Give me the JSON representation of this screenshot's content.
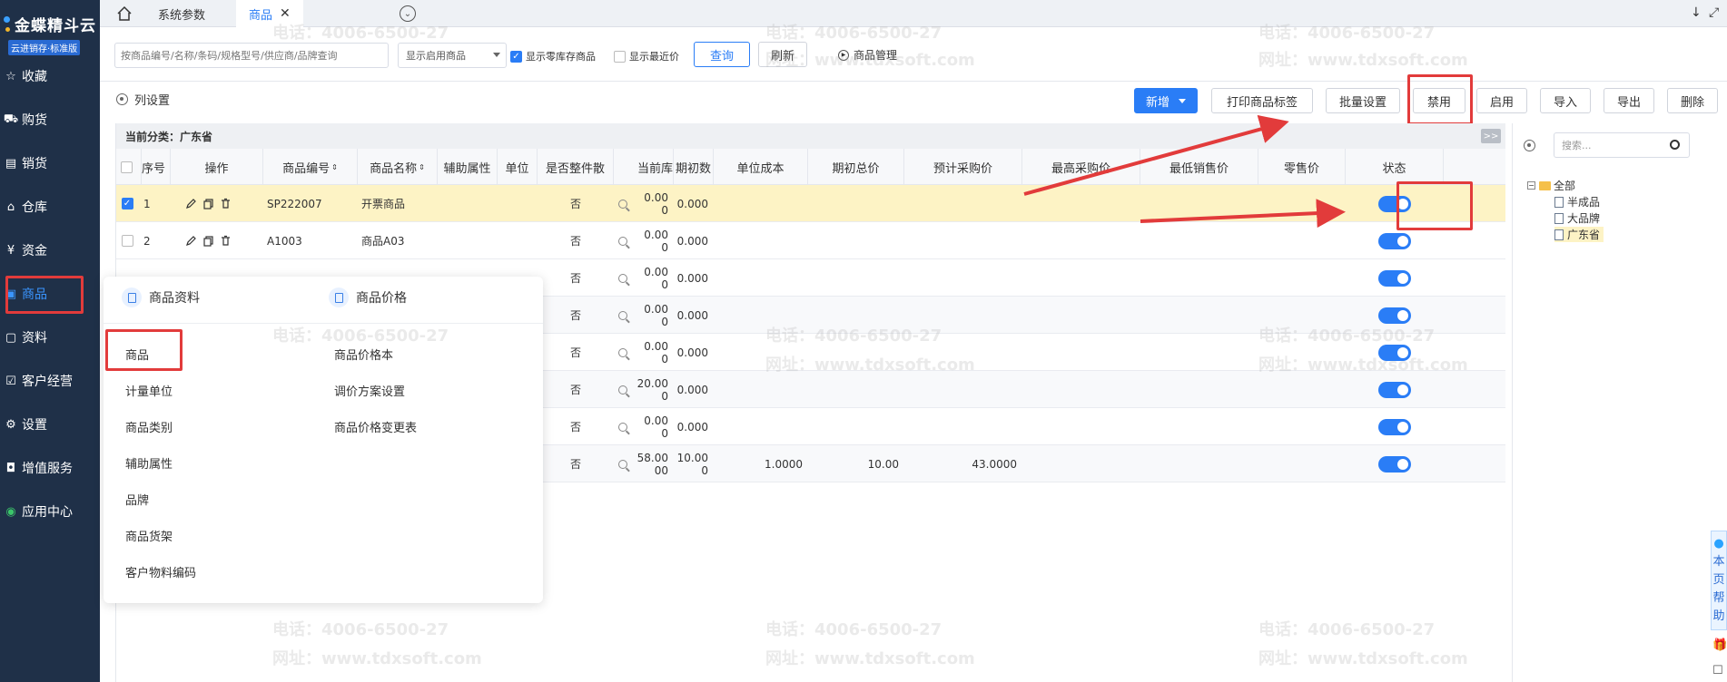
{
  "sidebar": {
    "logo_main": "金蝶精斗云",
    "logo_sub": "云进销存·标准版",
    "items": [
      {
        "label": "收藏",
        "icon": "star-icon"
      },
      {
        "label": "购货",
        "icon": "cart-icon"
      },
      {
        "label": "销货",
        "icon": "receipt-icon"
      },
      {
        "label": "仓库",
        "icon": "warehouse-icon"
      },
      {
        "label": "资金",
        "icon": "money-icon"
      },
      {
        "label": "商品",
        "icon": "goods-icon",
        "active": true
      },
      {
        "label": "资料",
        "icon": "data-icon"
      },
      {
        "label": "客户经营",
        "icon": "customer-icon"
      },
      {
        "label": "设置",
        "icon": "settings-icon"
      },
      {
        "label": "增值服务",
        "icon": "service-icon"
      },
      {
        "label": "应用中心",
        "icon": "apps-icon"
      }
    ]
  },
  "tabs": {
    "items": [
      {
        "label": "系统参数",
        "active": false
      },
      {
        "label": "商品",
        "active": true
      }
    ]
  },
  "toolbar": {
    "search_placeholder": "按商品编号/名称/条码/规格型号/供应商/品牌查询",
    "select_value": "显示启用商品",
    "chk_zero_stock": "显示零库存商品",
    "chk_recent_price": "显示最近价",
    "query_label": "查询",
    "refresh_label": "刷新",
    "goods_mgmt_label": "商品管理"
  },
  "actions": {
    "column_settings": "列设置",
    "add_label": "新增",
    "print_label": "打印商品标签",
    "batch_label": "批量设置",
    "disable_label": "禁用",
    "enable_label": "启用",
    "import_label": "导入",
    "export_label": "导出",
    "delete_label": "删除"
  },
  "table": {
    "category_label": "当前分类：广东省",
    "collapse_label": ">>",
    "headers": {
      "seq": "序号",
      "op": "操作",
      "code": "商品编号",
      "name": "商品名称",
      "attr": "辅助属性",
      "unit": "单位",
      "whole": "是否整件散",
      "stock": "当前库",
      "init_qty": "期初数",
      "unit_cost": "单位成本",
      "init_total": "期初总价",
      "purchase": "预计采购价",
      "max_purchase": "最高采购价",
      "min_sale": "最低销售价",
      "retail": "零售价",
      "status": "状态"
    },
    "rows": [
      {
        "seq": "1",
        "code": "SP222007",
        "name": "开票商品",
        "whole": "否",
        "stock_a": "0.00",
        "stock_b": "0",
        "init_qty": "0.000",
        "unit_cost": "",
        "init_total": "",
        "purchase": "",
        "selected": true
      },
      {
        "seq": "2",
        "code": "A1003",
        "name": "商品A03",
        "whole": "否",
        "stock_a": "0.00",
        "stock_b": "0",
        "init_qty": "0.000",
        "unit_cost": "",
        "init_total": "",
        "purchase": ""
      },
      {
        "seq": "",
        "code": "",
        "name": "",
        "whole": "否",
        "stock_a": "0.00",
        "stock_b": "0",
        "init_qty": "0.000",
        "unit_cost": "",
        "init_total": "",
        "purchase": ""
      },
      {
        "seq": "",
        "code": "",
        "name": "",
        "whole": "否",
        "stock_a": "0.00",
        "stock_b": "0",
        "init_qty": "0.000",
        "unit_cost": "",
        "init_total": "",
        "purchase": ""
      },
      {
        "seq": "",
        "code": "",
        "name": "",
        "whole": "否",
        "stock_a": "0.00",
        "stock_b": "0",
        "init_qty": "0.000",
        "unit_cost": "",
        "init_total": "",
        "purchase": ""
      },
      {
        "seq": "",
        "code": "",
        "name": "",
        "whole": "否",
        "stock_a": "20.00",
        "stock_b": "0",
        "init_qty": "0.000",
        "unit_cost": "",
        "init_total": "",
        "purchase": ""
      },
      {
        "seq": "",
        "code": "",
        "name": "",
        "whole": "否",
        "stock_a": "0.00",
        "stock_b": "0",
        "init_qty": "0.000",
        "unit_cost": "",
        "init_total": "",
        "purchase": ""
      },
      {
        "seq": "",
        "code": "",
        "name": "",
        "whole": "否",
        "stock_a": "58.00",
        "stock_b": "00",
        "init_qty": "10.00",
        "init_qty_b": "0",
        "unit_cost": "1.0000",
        "init_total": "10.00",
        "purchase": "43.0000"
      }
    ]
  },
  "tree": {
    "search_placeholder": "搜索...",
    "root": "全部",
    "nodes": [
      "半成品",
      "大品牌",
      "广东省"
    ]
  },
  "help": {
    "chars": [
      "本",
      "页",
      "帮",
      "助"
    ]
  },
  "popup": {
    "col1_title": "商品资料",
    "col2_title": "商品价格",
    "col1_items": [
      "商品",
      "计量单位",
      "商品类别",
      "辅助属性",
      "品牌",
      "商品货架",
      "客户物料编码"
    ],
    "col2_items": [
      "商品价格本",
      "调价方案设置",
      "商品价格变更表"
    ]
  },
  "watermark": {
    "phone": "电话：4006-6500-27",
    "site": "网址：www.tdxsoft.com"
  },
  "colors": {
    "accent": "#2a7df6",
    "highlight": "#e23b3b",
    "sidebar": "#1f3048",
    "selected_row": "#fdf3c5"
  }
}
